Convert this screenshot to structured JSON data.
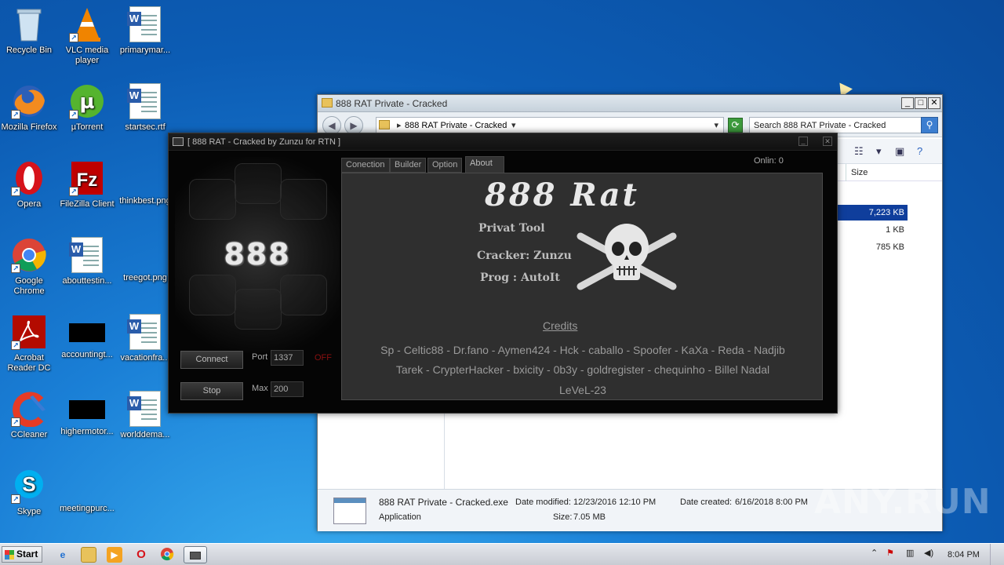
{
  "desktop": {
    "icons": [
      {
        "label": "Recycle Bin",
        "icon": "recycle-bin-icon"
      },
      {
        "label": "VLC media player",
        "icon": "vlc-icon"
      },
      {
        "label": "primarymar...",
        "icon": "word-doc-icon"
      },
      {
        "label": "Mozilla Firefox",
        "icon": "firefox-icon"
      },
      {
        "label": "µTorrent",
        "icon": "utorrent-icon"
      },
      {
        "label": "startsec.rtf",
        "icon": "word-doc-icon"
      },
      {
        "label": "Opera",
        "icon": "opera-icon"
      },
      {
        "label": "FileZilla Client",
        "icon": "filezilla-icon"
      },
      {
        "label": "thinkbest.png",
        "icon": "image-file-icon"
      },
      {
        "label": "Google Chrome",
        "icon": "chrome-icon"
      },
      {
        "label": "abouttestin...",
        "icon": "word-doc-icon"
      },
      {
        "label": "treegot.png",
        "icon": "image-file-icon"
      },
      {
        "label": "Acrobat Reader DC",
        "icon": "acrobat-icon"
      },
      {
        "label": "accountingt...",
        "icon": "image-file-icon"
      },
      {
        "label": "vacationfra...",
        "icon": "word-doc-icon"
      },
      {
        "label": "CCleaner",
        "icon": "ccleaner-icon"
      },
      {
        "label": "highermotor...",
        "icon": "image-file-icon"
      },
      {
        "label": "worlddema...",
        "icon": "word-doc-icon"
      },
      {
        "label": "Skype",
        "icon": "skype-icon"
      },
      {
        "label": "meetingpurc...",
        "icon": "image-file-icon"
      }
    ]
  },
  "explorer": {
    "title": "888 RAT Private - Cracked",
    "address": "888 RAT Private - Cracked",
    "search_placeholder": "Search 888 RAT Private - Cracked",
    "column_size": "Size",
    "sizes": [
      "7,223 KB",
      "1 KB",
      "785 KB"
    ],
    "status": {
      "filename": "888 RAT Private - Cracked.exe",
      "type": "Application",
      "date_modified_label": "Date modified:",
      "date_modified": "12/23/2016 12:10 PM",
      "size_label": "Size:",
      "size": "7.05 MB",
      "date_created_label": "Date created:",
      "date_created": "6/16/2018 8:00 PM"
    }
  },
  "rat": {
    "title": "[  888 RAT - Cracked by Zunzu for RTN ]",
    "logo": "888",
    "online_label": "Onlin:  0",
    "tabs": [
      "Conection",
      "Builder",
      "Option",
      "About"
    ],
    "active_tab": "About",
    "connect_label": "Connect",
    "stop_label": "Stop",
    "port_label": "Port",
    "port_value": "1337",
    "max_label": "Max",
    "max_value": "200",
    "status": "OFF",
    "about": {
      "title": "888 Rat",
      "line1": "Privat Tool",
      "line2": "Cracker: Zunzu",
      "line3": "Prog : AutoIt",
      "credits_heading": "Credits",
      "credits": [
        "Sp - Celtic88 - Dr.fano - Aymen424 - Hck - caballo - Spoofer - KaXa - Reda - Nadjib",
        "Tarek - CrypterHacker - bxicity - 0b3y - goldregister - chequinho - Billel Nadal",
        "LeVeL-23"
      ]
    }
  },
  "taskbar": {
    "start_label": "Start",
    "time": "8:04 PM"
  },
  "watermark": "ANY.RUN",
  "colors": {
    "desktop_blue": "#0c5cb4",
    "rat_off": "#8a1010",
    "selection": "#0f3e9c"
  }
}
